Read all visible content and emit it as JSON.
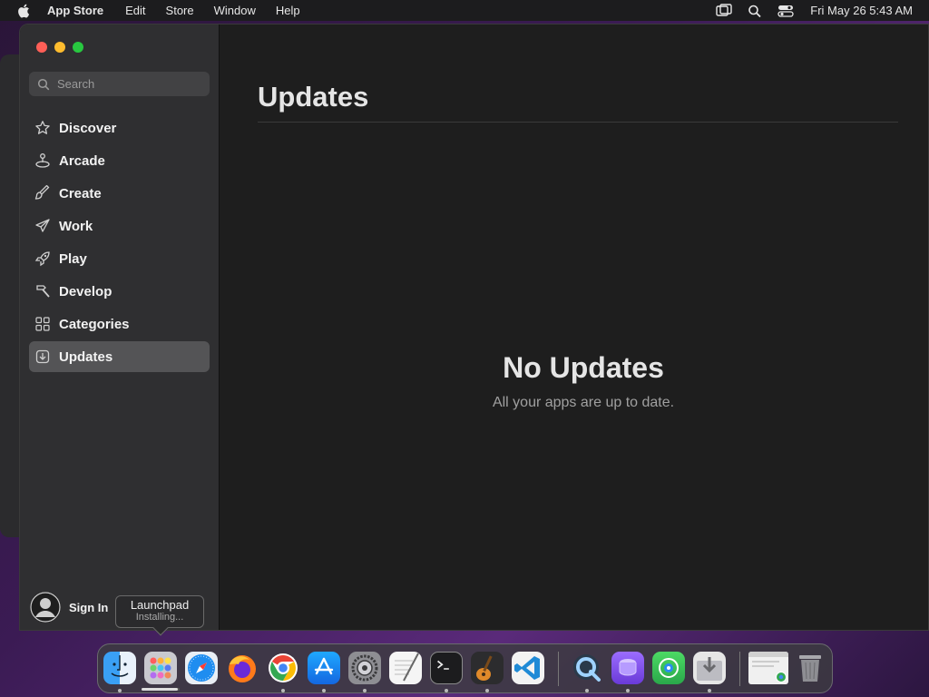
{
  "menubar": {
    "app_name": "App Store",
    "menus": [
      "Edit",
      "Store",
      "Window",
      "Help"
    ],
    "clock": "Fri May 26  5:43 AM"
  },
  "search": {
    "placeholder": "Search"
  },
  "sidebar": {
    "items": [
      {
        "label": "Discover",
        "icon": "star-icon"
      },
      {
        "label": "Arcade",
        "icon": "joystick-icon"
      },
      {
        "label": "Create",
        "icon": "brush-icon"
      },
      {
        "label": "Work",
        "icon": "paper-plane-icon"
      },
      {
        "label": "Play",
        "icon": "rocket-icon"
      },
      {
        "label": "Develop",
        "icon": "hammer-icon"
      },
      {
        "label": "Categories",
        "icon": "grid-icon"
      },
      {
        "label": "Updates",
        "icon": "download-icon",
        "active": true
      }
    ],
    "sign_in": "Sign In"
  },
  "main": {
    "title": "Updates",
    "empty_title": "No Updates",
    "empty_subtitle": "All your apps are up to date."
  },
  "tooltip": {
    "title": "Launchpad",
    "subtitle": "Installing..."
  },
  "dock": {
    "apps": [
      "finder",
      "launchpad",
      "safari",
      "firefox",
      "chrome",
      "app-store",
      "system-settings",
      "textedit",
      "terminal",
      "garageband",
      "vscode",
      "quicktime",
      "disk-utility",
      "find-my",
      "downloads",
      "chrome-window",
      "trash"
    ],
    "launchpad_install_progress": 0.95
  },
  "colors": {
    "accent_active": "#545456",
    "close": "#ff5f57",
    "minimize": "#febc2e",
    "zoom": "#28c840"
  }
}
